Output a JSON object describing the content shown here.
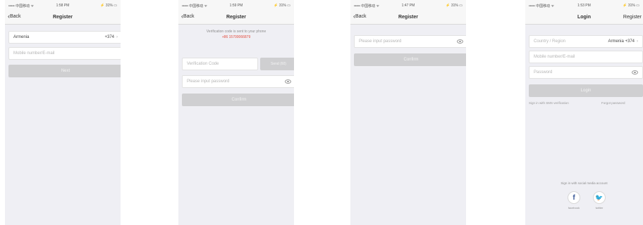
{
  "status_bar": {
    "carrier": "••••• 中国移动 ᯤ",
    "battery": "⚡ 31% ▭"
  },
  "screen1": {
    "time": "1:58 PM",
    "back_label": "Back",
    "title": "Register",
    "country": "Armenia",
    "code": "+374",
    "mobile_placeholder": "Mobile number/E-mail",
    "next_label": "Next"
  },
  "screen2": {
    "time": "1:59 PM",
    "back_label": "Back",
    "title": "Register",
    "sent_message": "Verification code is sent to your phone",
    "phone_number": "+86 15700066879",
    "code_placeholder": "Verification Code",
    "send_label": "Send (60)",
    "password_placeholder": "Please input password",
    "confirm_label": "Confirm"
  },
  "screen3": {
    "time": "1:47 PM",
    "back_label": "Back",
    "title": "Register",
    "password_placeholder": "Please input password",
    "confirm_label": "Confirm"
  },
  "screen4": {
    "time": "1:53 PM",
    "title": "Login",
    "right_label": "Register",
    "country_label": "Country / Region",
    "country_value": "Armenia +374",
    "mobile_placeholder": "Mobile number/E-mail",
    "password_placeholder": "Password",
    "login_label": "Login",
    "sms_link": "Sign in with SMS verification",
    "forgot_link": "Forgot password",
    "social_caption": "Sign in with social media account",
    "facebook_label": "facebook",
    "twitter_label": "twitter"
  },
  "colors": {
    "accent_red": "#e34b3c",
    "disabled_button": "#cfcfd1",
    "background": "#efeff4"
  }
}
